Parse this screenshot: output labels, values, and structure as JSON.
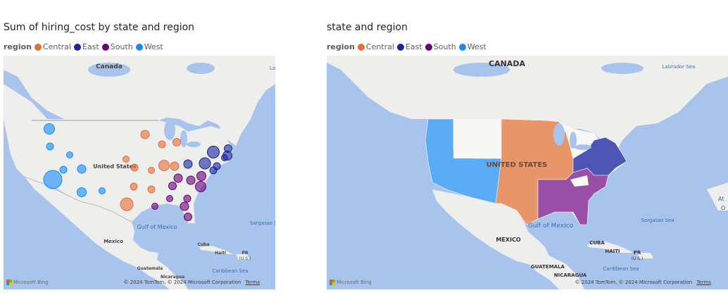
{
  "visuals": [
    {
      "title": "Sum of hiring_cost by state and region",
      "legend_title": "region",
      "legend": [
        {
          "label": "Central",
          "color": "#e66c37"
        },
        {
          "label": "East",
          "color": "#1a259f"
        },
        {
          "label": "South",
          "color": "#6b007b"
        },
        {
          "label": "West",
          "color": "#118dff"
        }
      ],
      "map_labels": {
        "canada": "Canada",
        "usa": "United States",
        "gulf": "Gulf of Mexico",
        "mexico": "Mexico",
        "cuba": "Cuba",
        "haiti": "Haiti",
        "pr": "PR",
        "pr_sub": "(U.S.)",
        "sargasso": "Sargasso S",
        "caribbean": "Caribbean Sea",
        "guatemala": "Guatemala",
        "nicaragua": "Nicaragua",
        "la": "La"
      },
      "attribution": {
        "bing": "Microsoft Bing",
        "copyright": "© 2024 TomTom, © 2024 Microsoft Corporation",
        "terms": "Terms"
      }
    },
    {
      "title": "state and region",
      "legend_title": "region",
      "legend": [
        {
          "label": "Central",
          "color": "#e66c37"
        },
        {
          "label": "East",
          "color": "#1a259f"
        },
        {
          "label": "South",
          "color": "#6b007b"
        },
        {
          "label": "West",
          "color": "#118dff"
        }
      ],
      "map_labels": {
        "canada": "CANADA",
        "usa": "UNITED STATES",
        "gulf": "Gulf of Mexico",
        "mexico": "MEXICO",
        "cuba": "CUBA",
        "haiti": "HAITI",
        "pr": "PR",
        "pr_sub": "(U.S.)",
        "sargasso": "Sargasso Sea",
        "caribbean": "Caribbean Sea",
        "guatemala": "GUATEMALA",
        "nicaragua": "NICARAGUA",
        "labrador": "Labrador Sea",
        "at": "At",
        "o": "O"
      },
      "attribution": {
        "bing": "Microsoft Bing",
        "copyright": "© 2024 TomTom, © 2024 Microsoft Corporation",
        "terms": "Terms"
      }
    }
  ],
  "bubbles": [
    {
      "region": "West",
      "size": 0.45
    },
    {
      "region": "West",
      "size": 0.2
    },
    {
      "region": "West",
      "size": 0.15
    },
    {
      "region": "West",
      "size": 1.0
    },
    {
      "region": "West",
      "size": 0.2
    },
    {
      "region": "West",
      "size": 0.35
    },
    {
      "region": "West",
      "size": 0.3
    },
    {
      "region": "West",
      "size": 0.15
    },
    {
      "region": "Central",
      "size": 0.3
    },
    {
      "region": "Central",
      "size": 0.2
    },
    {
      "region": "Central",
      "size": 0.25
    },
    {
      "region": "Central",
      "size": 0.15
    },
    {
      "region": "Central",
      "size": 0.2
    },
    {
      "region": "Central",
      "size": 0.45
    },
    {
      "region": "Central",
      "size": 0.3
    },
    {
      "region": "Central",
      "size": 0.15
    },
    {
      "region": "Central",
      "size": 0.6
    },
    {
      "region": "Central",
      "size": 0.2
    },
    {
      "region": "Central",
      "size": 0.2
    },
    {
      "region": "East",
      "size": 0.55
    },
    {
      "region": "East",
      "size": 0.35
    },
    {
      "region": "East",
      "size": 0.5
    },
    {
      "region": "East",
      "size": 0.3
    },
    {
      "region": "East",
      "size": 0.2
    },
    {
      "region": "East",
      "size": 0.15
    },
    {
      "region": "East",
      "size": 0.25
    },
    {
      "region": "East",
      "size": 0.2
    },
    {
      "region": "South",
      "size": 0.35
    },
    {
      "region": "South",
      "size": 0.3
    },
    {
      "region": "South",
      "size": 0.3
    },
    {
      "region": "South",
      "size": 0.45
    },
    {
      "region": "South",
      "size": 0.25
    },
    {
      "region": "South",
      "size": 0.2
    },
    {
      "region": "South",
      "size": 0.15
    },
    {
      "region": "South",
      "size": 0.3
    },
    {
      "region": "South",
      "size": 0.25
    },
    {
      "region": "South",
      "size": 0.15
    }
  ],
  "region_colors": {
    "Central": "#e66c37",
    "East": "#1a259f",
    "South": "#6b007b",
    "West": "#118dff"
  },
  "filled_colors": {
    "Central": "#e8956a",
    "East": "#4d55b5",
    "South": "#9a4fa6",
    "West": "#5aacf6"
  }
}
